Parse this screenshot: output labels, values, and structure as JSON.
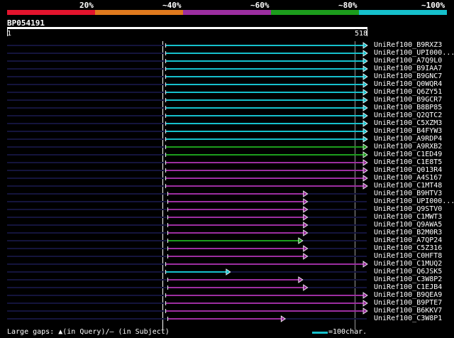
{
  "legend": {
    "labels": [
      "20%",
      "~40%",
      "~60%",
      "~80%",
      "~100%"
    ],
    "colors": [
      "#e3142d",
      "#e07a1e",
      "#9c2ea0",
      "#1c9c1c",
      "#16c0cc"
    ]
  },
  "query": {
    "name": "BP054191",
    "start": "1",
    "end": "518",
    "length": 518
  },
  "hits": [
    {
      "name": "UniRef100_B9RXZ3",
      "color": "#16c0cc",
      "s": 229,
      "e": 518
    },
    {
      "name": "UniRef100_UPI000...",
      "color": "#16c0cc",
      "s": 229,
      "e": 518
    },
    {
      "name": "UniRef100_A7Q9L0",
      "color": "#16c0cc",
      "s": 229,
      "e": 518
    },
    {
      "name": "UniRef100_B9IAA7",
      "color": "#16c0cc",
      "s": 229,
      "e": 518
    },
    {
      "name": "UniRef100_B9GNC7",
      "color": "#16c0cc",
      "s": 229,
      "e": 518
    },
    {
      "name": "UniRef100_Q0WQR4",
      "color": "#16c0cc",
      "s": 229,
      "e": 518
    },
    {
      "name": "UniRef100_Q6ZY51",
      "color": "#16c0cc",
      "s": 229,
      "e": 518
    },
    {
      "name": "UniRef100_B9GCR7",
      "color": "#16c0cc",
      "s": 229,
      "e": 518
    },
    {
      "name": "UniRef100_B8BP85",
      "color": "#16c0cc",
      "s": 229,
      "e": 518
    },
    {
      "name": "UniRef100_Q2QTC2",
      "color": "#16c0cc",
      "s": 229,
      "e": 518
    },
    {
      "name": "UniRef100_C5XZM3",
      "color": "#16c0cc",
      "s": 229,
      "e": 518
    },
    {
      "name": "UniRef100_B4FYW3",
      "color": "#16c0cc",
      "s": 229,
      "e": 518
    },
    {
      "name": "UniRef100_A9RDP4",
      "color": "#16c0cc",
      "s": 229,
      "e": 518
    },
    {
      "name": "UniRef100_A9RXB2",
      "color": "#1c9c1c",
      "s": 229,
      "e": 518
    },
    {
      "name": "UniRef100_C1ED49",
      "color": "#1c9c1c",
      "s": 229,
      "e": 518
    },
    {
      "name": "UniRef100_C1E8T5",
      "color": "#9c2ea0",
      "s": 229,
      "e": 518
    },
    {
      "name": "UniRef100_Q013R4",
      "color": "#9c2ea0",
      "s": 229,
      "e": 518
    },
    {
      "name": "UniRef100_A4S167",
      "color": "#9c2ea0",
      "s": 229,
      "e": 518
    },
    {
      "name": "UniRef100_C1MT48",
      "color": "#9c2ea0",
      "s": 229,
      "e": 518
    },
    {
      "name": "UniRef100_B9HTV3",
      "color": "#9c2ea0",
      "s": 232,
      "e": 432
    },
    {
      "name": "UniRef100_UPI000...",
      "color": "#9c2ea0",
      "s": 232,
      "e": 432
    },
    {
      "name": "UniRef100_Q9STV0",
      "color": "#9c2ea0",
      "s": 232,
      "e": 432
    },
    {
      "name": "UniRef100_C1MWT3",
      "color": "#9c2ea0",
      "s": 232,
      "e": 432
    },
    {
      "name": "UniRef100_Q9AWA5",
      "color": "#9c2ea0",
      "s": 232,
      "e": 432
    },
    {
      "name": "UniRef100_B2M0R3",
      "color": "#9c2ea0",
      "s": 232,
      "e": 432
    },
    {
      "name": "UniRef100_A7QP24",
      "color": "#1c9c1c",
      "s": 232,
      "e": 425
    },
    {
      "name": "UniRef100_C5Z316",
      "color": "#9c2ea0",
      "s": 232,
      "e": 432
    },
    {
      "name": "UniRef100_C0HFT8",
      "color": "#9c2ea0",
      "s": 232,
      "e": 432
    },
    {
      "name": "UniRef100_C1MUQ2",
      "color": "#9c2ea0",
      "s": 229,
      "e": 518
    },
    {
      "name": "UniRef100_Q6JSK5",
      "color": "#16c0cc",
      "s": 229,
      "e": 321
    },
    {
      "name": "UniRef100_C3W8P2",
      "color": "#9c2ea0",
      "s": 232,
      "e": 425
    },
    {
      "name": "UniRef100_C1EJB4",
      "color": "#9c2ea0",
      "s": 232,
      "e": 432
    },
    {
      "name": "UniRef100_B9QEA9",
      "color": "#9c2ea0",
      "s": 229,
      "e": 518
    },
    {
      "name": "UniRef100_B9PTE7",
      "color": "#9c2ea0",
      "s": 229,
      "e": 518
    },
    {
      "name": "UniRef100_B6KKV7",
      "color": "#9c2ea0",
      "s": 229,
      "e": 518
    },
    {
      "name": "UniRef100_C3W8P1",
      "color": "#9c2ea0",
      "s": 232,
      "e": 400
    }
  ],
  "footer": {
    "gaps_text": "Large gaps: ▲(in Query)/— (in Subject)",
    "scale_text": "=100char."
  }
}
